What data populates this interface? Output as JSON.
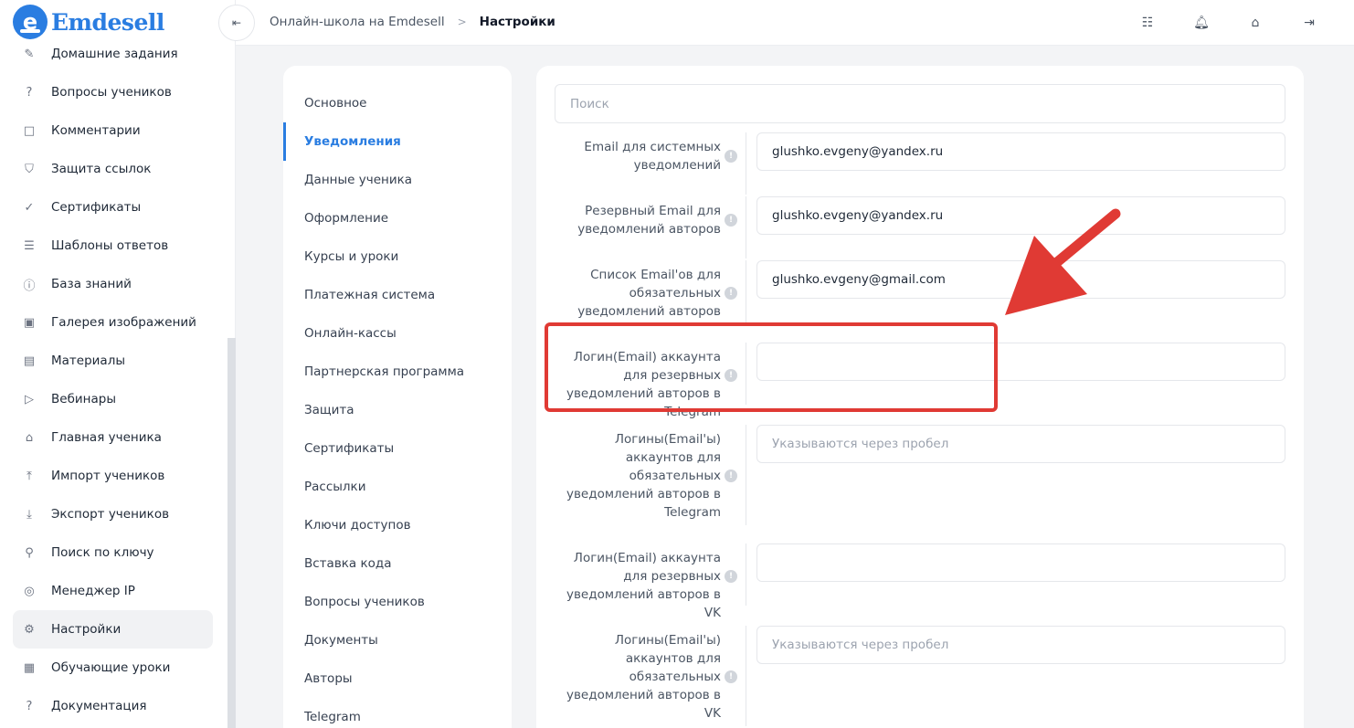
{
  "brand": {
    "name": "Emdesell",
    "logo_letter": "e",
    "color": "#2a7de1"
  },
  "sidebar": {
    "items": [
      {
        "label": "Домашние задания",
        "icon": "pencil-icon",
        "glyph": "✎"
      },
      {
        "label": "Вопросы учеников",
        "icon": "question-icon",
        "glyph": "?"
      },
      {
        "label": "Комментарии",
        "icon": "comment-icon",
        "glyph": "□"
      },
      {
        "label": "Защита ссылок",
        "icon": "shield-icon",
        "glyph": "⛉"
      },
      {
        "label": "Сертификаты",
        "icon": "badge-check-icon",
        "glyph": "✓"
      },
      {
        "label": "Шаблоны ответов",
        "icon": "list-icon",
        "glyph": "☰"
      },
      {
        "label": "База знаний",
        "icon": "info-icon",
        "glyph": "ⓘ"
      },
      {
        "label": "Галерея изображений",
        "icon": "image-icon",
        "glyph": "▣"
      },
      {
        "label": "Материалы",
        "icon": "briefcase-icon",
        "glyph": "▤"
      },
      {
        "label": "Вебинары",
        "icon": "play-icon",
        "glyph": "▷"
      },
      {
        "label": "Главная ученика",
        "icon": "home-icon",
        "glyph": "⌂"
      },
      {
        "label": "Импорт учеников",
        "icon": "upload-icon",
        "glyph": "⤒"
      },
      {
        "label": "Экспорт учеников",
        "icon": "download-icon",
        "glyph": "⤓"
      },
      {
        "label": "Поиск по ключу",
        "icon": "search-icon",
        "glyph": "⚲"
      },
      {
        "label": "Менеджер IP",
        "icon": "target-icon",
        "glyph": "◎"
      },
      {
        "label": "Настройки",
        "icon": "gear-icon",
        "glyph": "⚙",
        "active": true
      },
      {
        "label": "Обучающие уроки",
        "icon": "film-icon",
        "glyph": "▦"
      },
      {
        "label": "Документация",
        "icon": "help-box-icon",
        "glyph": "?"
      }
    ]
  },
  "header": {
    "collapse_glyph": "⇤",
    "breadcrumb": [
      "Онлайн-школа на Emdesell",
      "Настройки"
    ],
    "separator": ">",
    "icons": [
      {
        "name": "sliders-icon",
        "glyph": "☷"
      },
      {
        "name": "bell-icon",
        "glyph": "🔔︎"
      },
      {
        "name": "home-settings-icon",
        "glyph": "⌂"
      },
      {
        "name": "logout-icon",
        "glyph": "⇥"
      }
    ]
  },
  "settings_menu": {
    "items": [
      {
        "label": "Основное"
      },
      {
        "label": "Уведомления",
        "active": true
      },
      {
        "label": "Данные ученика"
      },
      {
        "label": "Оформление"
      },
      {
        "label": "Курсы и уроки"
      },
      {
        "label": "Платежная система"
      },
      {
        "label": "Онлайн-кассы"
      },
      {
        "label": "Партнерская программа"
      },
      {
        "label": "Защита"
      },
      {
        "label": "Сертификаты"
      },
      {
        "label": "Рассылки"
      },
      {
        "label": "Ключи доступов"
      },
      {
        "label": "Вставка кода"
      },
      {
        "label": "Вопросы учеников"
      },
      {
        "label": "Документы"
      },
      {
        "label": "Авторы"
      },
      {
        "label": "Telegram"
      }
    ]
  },
  "form": {
    "search_placeholder": "Поиск",
    "info_glyph": "!",
    "fields": [
      {
        "label": "Email для системных уведомлений",
        "value": "glushko.evgeny@yandex.ru",
        "placeholder": ""
      },
      {
        "label": "Резервный Email для уведомлений авторов",
        "value": "glushko.evgeny@yandex.ru",
        "placeholder": ""
      },
      {
        "label": "Список Email'ов для обязательных уведомлений авторов",
        "value": "glushko.evgeny@gmail.com",
        "placeholder": ""
      },
      {
        "label": "Логин(Email) аккаунта для резервных уведомлений авторов в Telegram",
        "value": "",
        "placeholder": ""
      },
      {
        "label": "Логины(Email'ы) аккаунтов для обязательных уведомлений авторов в Telegram",
        "value": "",
        "placeholder": "Указываются через пробел"
      },
      {
        "label": "Логин(Email) аккаунта для резервных уведомлений авторов в VK",
        "value": "",
        "placeholder": ""
      },
      {
        "label": "Логины(Email'ы) аккаунтов для обязательных уведомлений авторов в VK",
        "value": "",
        "placeholder": "Указываются через пробел"
      }
    ]
  },
  "annotation": {
    "color": "#e03a34"
  }
}
